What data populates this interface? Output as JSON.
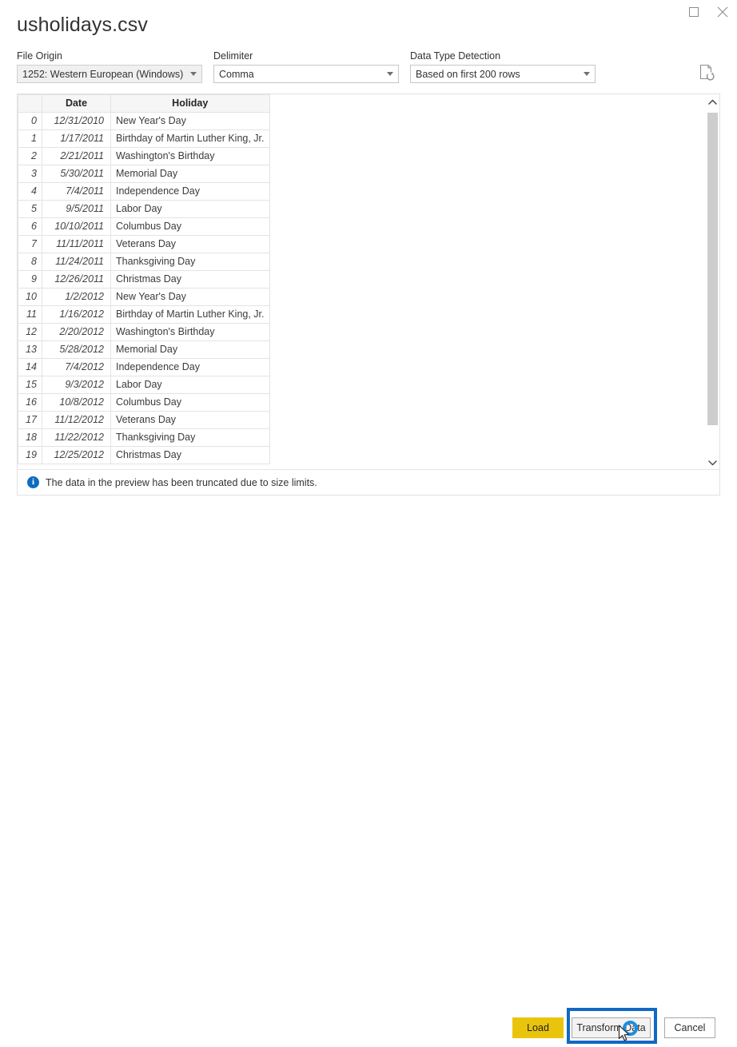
{
  "window": {
    "maximize_label": "Maximize",
    "close_label": "Close"
  },
  "dialog": {
    "title": "usholidays.csv"
  },
  "options": {
    "file_origin": {
      "label": "File Origin",
      "value": "1252: Western European (Windows)"
    },
    "delimiter": {
      "label": "Delimiter",
      "value": "Comma"
    },
    "data_type_detection": {
      "label": "Data Type Detection",
      "value": "Based on first 200 rows"
    },
    "refresh_icon": "refresh-preview-icon"
  },
  "preview": {
    "columns": [
      "",
      "Date",
      "Holiday"
    ],
    "rows": [
      [
        "0",
        "12/31/2010",
        "New Year's Day"
      ],
      [
        "1",
        "1/17/2011",
        "Birthday of Martin Luther King, Jr."
      ],
      [
        "2",
        "2/21/2011",
        "Washington's Birthday"
      ],
      [
        "3",
        "5/30/2011",
        "Memorial Day"
      ],
      [
        "4",
        "7/4/2011",
        "Independence Day"
      ],
      [
        "5",
        "9/5/2011",
        "Labor Day"
      ],
      [
        "6",
        "10/10/2011",
        "Columbus Day"
      ],
      [
        "7",
        "11/11/2011",
        "Veterans Day"
      ],
      [
        "8",
        "11/24/2011",
        "Thanksgiving Day"
      ],
      [
        "9",
        "12/26/2011",
        "Christmas Day"
      ],
      [
        "10",
        "1/2/2012",
        "New Year's Day"
      ],
      [
        "11",
        "1/16/2012",
        "Birthday of Martin Luther King, Jr."
      ],
      [
        "12",
        "2/20/2012",
        "Washington's Birthday"
      ],
      [
        "13",
        "5/28/2012",
        "Memorial Day"
      ],
      [
        "14",
        "7/4/2012",
        "Independence Day"
      ],
      [
        "15",
        "9/3/2012",
        "Labor Day"
      ],
      [
        "16",
        "10/8/2012",
        "Columbus Day"
      ],
      [
        "17",
        "11/12/2012",
        "Veterans Day"
      ],
      [
        "18",
        "11/22/2012",
        "Thanksgiving Day"
      ],
      [
        "19",
        "12/25/2012",
        "Christmas Day"
      ]
    ],
    "info_message": "The data in the preview has been truncated due to size limits.",
    "info_icon": "info-icon"
  },
  "footer": {
    "load_label": "Load",
    "transform_label": "Transform Data",
    "cancel_label": "Cancel"
  },
  "colors": {
    "accent_yellow": "#e9c40c",
    "focus_blue": "#1268c3",
    "info_blue": "#0f6cbd",
    "click_marker_blue": "#1a8fe0"
  }
}
